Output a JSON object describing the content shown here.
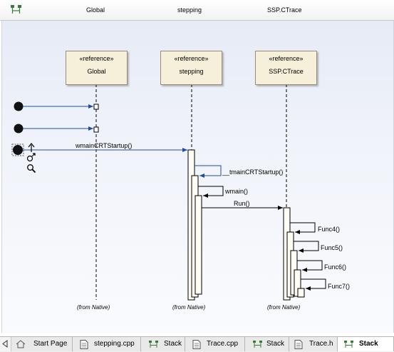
{
  "header": {
    "columns": [
      "Global",
      "stepping",
      "SSP.CTrace"
    ]
  },
  "lifelines": [
    {
      "stereotype": "«reference»",
      "name": "Global",
      "from": "(from Native)"
    },
    {
      "stereotype": "«reference»",
      "name": "stepping",
      "from": "(from Native)"
    },
    {
      "stereotype": "«reference»",
      "name": "SSP.CTrace",
      "from": "(from Native)"
    }
  ],
  "messages": [
    "wmainCRTStartup()",
    "__tmainCRTStartup()",
    "wmain()",
    "Run()",
    "Func4()",
    "Func5()",
    "Func6()",
    "Func7()"
  ],
  "tool_icons": [
    "actor-up-arrow-icon",
    "gender-symbol-icon",
    "magnifier-icon"
  ],
  "tabs": [
    {
      "label": "Start Page",
      "icon": "start-page-icon",
      "active": false
    },
    {
      "label": "stepping.cpp",
      "icon": "document-icon",
      "active": false
    },
    {
      "label": "Stack",
      "icon": "sequence-diagram-icon",
      "active": false
    },
    {
      "label": "Trace.cpp",
      "icon": "document-icon",
      "active": false
    },
    {
      "label": "Stack",
      "icon": "sequence-diagram-icon",
      "active": false
    },
    {
      "label": "Trace.h",
      "icon": "document-icon",
      "active": false
    },
    {
      "label": "Stack",
      "icon": "sequence-diagram-icon",
      "active": true
    }
  ],
  "colors": {
    "message_arrow": "#1f4fa3",
    "return_arrow": "#000000",
    "activation_fill": "#fffdf4",
    "lifeline_head_fill": "#f6efd9"
  }
}
